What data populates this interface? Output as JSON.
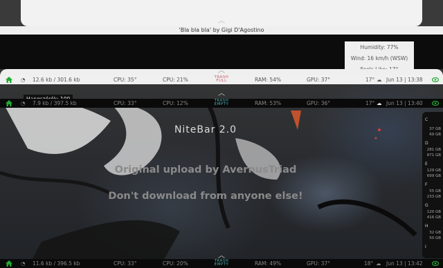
{
  "song": {
    "title": "'Bla bla bla' by Gigi D'Agostino"
  },
  "weather": {
    "humidity": "Humidity: 77%",
    "wind": "Wind: 16 km/h (WSW)",
    "feels": "Feels Like: 17°"
  },
  "bars": [
    {
      "net": "12.6 kb / 301.6 kb",
      "cpu_temp": "CPU: 35°",
      "cpu": "CPU: 21%",
      "trash": [
        "TRASH",
        "FULL"
      ],
      "ram": "RAM: 54%",
      "gpu": "GPU: 37°",
      "temp": "17°",
      "date": "Jun 13 | 13:38"
    },
    {
      "net": "7.9 kb / 397.5 kb",
      "cpu_temp": "CPU: 33°",
      "cpu": "CPU: 12%",
      "trash": [
        "TRASH",
        "EMPTY"
      ],
      "ram": "RAM: 53%",
      "gpu": "GPU: 36°",
      "temp": "17°",
      "date": "Jun 13 | 13:40"
    },
    {
      "net": "11.6 kb / 396.5 kb",
      "cpu_temp": "CPU: 33°",
      "cpu": "CPU: 20%",
      "trash": [
        "TRASH",
        "EMPTY"
      ],
      "ram": "RAM: 49%",
      "gpu": "GPU: 37°",
      "temp": "18°",
      "date": "Jun 13 | 13:42"
    }
  ],
  "tooltip": "Hangszórók: 100",
  "center": {
    "title": "NiteBar 2.0",
    "line1": "Original upload by AvernusTriad",
    "line2": "Don't download from anyone else!"
  },
  "disks": [
    {
      "letter": "C",
      "a": "37 GB",
      "b": "69 GB"
    },
    {
      "letter": "D",
      "a": "281 GB",
      "b": "871 GB"
    },
    {
      "letter": "E",
      "a": "129 GB",
      "b": "699 GB"
    },
    {
      "letter": "F",
      "a": "55 GB",
      "b": "233 GB"
    },
    {
      "letter": "G",
      "a": "120 GB",
      "b": "416 GB"
    },
    {
      "letter": "H",
      "a": "32 GB",
      "b": "50 GB"
    },
    {
      "letter": "I",
      "a": "",
      "b": ""
    }
  ],
  "colors": {
    "accent_green": "#22aa33",
    "trash_red": "#cc5566",
    "trash_teal": "#4fb3b3"
  }
}
